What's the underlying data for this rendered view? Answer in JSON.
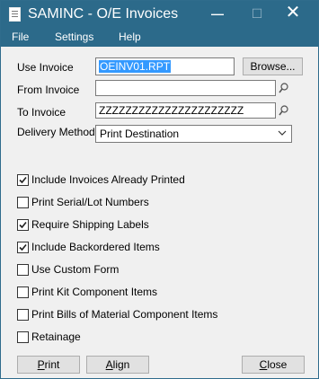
{
  "window": {
    "title": "SAMINC - O/E Invoices",
    "minimize_glyph": "—",
    "maximize_glyph": "☐",
    "close_glyph": "✕"
  },
  "menu": [
    "File",
    "Settings",
    "Help"
  ],
  "form": {
    "use_invoice": {
      "label": "Use Invoice",
      "value": "OEINV01.RPT",
      "browse_label": "Browse..."
    },
    "from_invoice": {
      "label": "From Invoice",
      "value": ""
    },
    "to_invoice": {
      "label": "To Invoice",
      "value": "ZZZZZZZZZZZZZZZZZZZZZZ"
    },
    "delivery_method": {
      "label": "Delivery Method",
      "value": "Print Destination"
    }
  },
  "options": [
    {
      "label": "Include Invoices Already Printed",
      "checked": true
    },
    {
      "label": "Print Serial/Lot Numbers",
      "checked": false
    },
    {
      "label": "Require Shipping Labels",
      "checked": true
    },
    {
      "label": "Include Backordered Items",
      "checked": true
    },
    {
      "label": "Use Custom Form",
      "checked": false
    },
    {
      "label": "Print Kit Component Items",
      "checked": false
    },
    {
      "label": "Print Bills of Material Component Items",
      "checked": false
    },
    {
      "label": "Retainage",
      "checked": false
    }
  ],
  "buttons": {
    "print": {
      "mnemonic": "P",
      "rest": "rint"
    },
    "align": {
      "mnemonic": "A",
      "rest": "lign"
    },
    "close": {
      "mnemonic": "C",
      "rest": "lose"
    }
  },
  "icons": {
    "app": "report-document-icon",
    "finder": "magnifier-icon",
    "dropdown": "chevron-down-icon",
    "check": "checkmark-icon"
  },
  "colors": {
    "titlebar": "#2c6a8a",
    "selection": "#3399ff",
    "dialog_bg": "#f0f0f0"
  }
}
